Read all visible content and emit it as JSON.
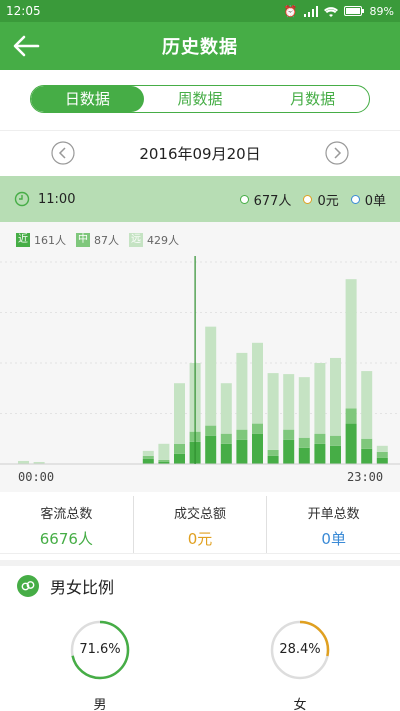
{
  "status": {
    "time": "12:05",
    "battery": "89%"
  },
  "appbar": {
    "title": "历史数据"
  },
  "tabs": [
    {
      "label": "日数据",
      "active": true
    },
    {
      "label": "周数据",
      "active": false
    },
    {
      "label": "月数据",
      "active": false
    }
  ],
  "date": {
    "value": "2016年09月20日"
  },
  "info": {
    "time": "11:00",
    "people": "677人",
    "amount": "0元",
    "orders": "0单",
    "colors": {
      "people": "#46ad46",
      "amount": "#e0a020",
      "orders": "#3a8ad6"
    }
  },
  "legend": [
    {
      "badge": "近",
      "text": "161人",
      "color": "#46ad46"
    },
    {
      "badge": "中",
      "text": "87人",
      "color": "#7fc77c"
    },
    {
      "badge": "远",
      "text": "429人",
      "color": "#c5e3c3"
    }
  ],
  "chart_data": {
    "type": "bar",
    "categories": [
      "00:00",
      "01:00",
      "02:00",
      "03:00",
      "04:00",
      "05:00",
      "06:00",
      "07:00",
      "08:00",
      "09:00",
      "10:00",
      "11:00",
      "12:00",
      "13:00",
      "14:00",
      "15:00",
      "16:00",
      "17:00",
      "18:00",
      "19:00",
      "20:00",
      "21:00",
      "22:00",
      "23:00"
    ],
    "series": [
      {
        "name": "近",
        "values": [
          0,
          0,
          0,
          0,
          0,
          0,
          0,
          0,
          5,
          2,
          10,
          22,
          28,
          20,
          24,
          30,
          8,
          24,
          16,
          20,
          18,
          40,
          15,
          6
        ]
      },
      {
        "name": "中",
        "values": [
          0,
          0,
          0,
          0,
          0,
          0,
          0,
          0,
          3,
          2,
          10,
          10,
          10,
          10,
          10,
          10,
          6,
          10,
          10,
          10,
          10,
          15,
          10,
          6
        ]
      },
      {
        "name": "远",
        "values": [
          3,
          2,
          0,
          0,
          0,
          0,
          0,
          0,
          5,
          16,
          60,
          68,
          98,
          50,
          76,
          80,
          76,
          55,
          60,
          70,
          77,
          128,
          67,
          6
        ]
      }
    ],
    "stacked": true,
    "selected_index": 11,
    "xlabels": {
      "start": "00:00",
      "end": "23:00"
    }
  },
  "totals": [
    {
      "label": "客流总数",
      "value": "6676人",
      "color": "#46ad46"
    },
    {
      "label": "成交总额",
      "value": "0元",
      "color": "#e0a020"
    },
    {
      "label": "开单总数",
      "value": "0单",
      "color": "#3a8ad6"
    }
  ],
  "gender": {
    "title": "男女比例",
    "male": {
      "percent": "71.6%",
      "label": "男",
      "fraction": 0.716,
      "color": "#46ad46"
    },
    "female": {
      "percent": "28.4%",
      "label": "女",
      "fraction": 0.284,
      "color": "#e0a020"
    }
  }
}
